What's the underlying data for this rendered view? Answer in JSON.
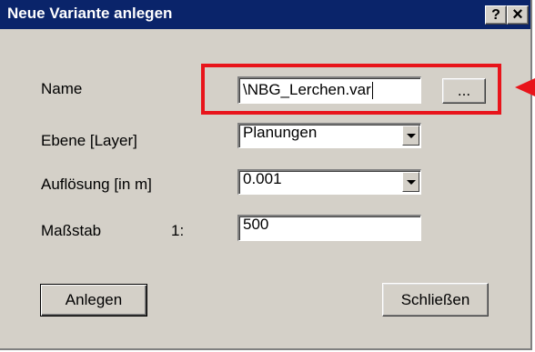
{
  "window": {
    "title": "Neue Variante anlegen",
    "help_glyph": "?",
    "close_glyph": "×"
  },
  "form": {
    "name_label": "Name",
    "name_value": "\\NBG_Lerchen.var",
    "browse_label": "...",
    "layer_label": "Ebene [Layer]",
    "layer_value": "Planungen",
    "resolution_label": "Auflösung [in m]",
    "resolution_value": "0.001",
    "scale_label": "Maßstab",
    "scale_prefix": "1:",
    "scale_value": "500"
  },
  "buttons": {
    "create_label": "Anlegen",
    "close_label": "Schließen"
  },
  "colors": {
    "titlebar": "#0a246a",
    "dialog_face": "#d4d0c8",
    "annotation_red": "#e8141b"
  },
  "icons": [
    "help-icon",
    "close-icon",
    "dropdown-arrow-icon",
    "annotation-arrow-icon"
  ]
}
